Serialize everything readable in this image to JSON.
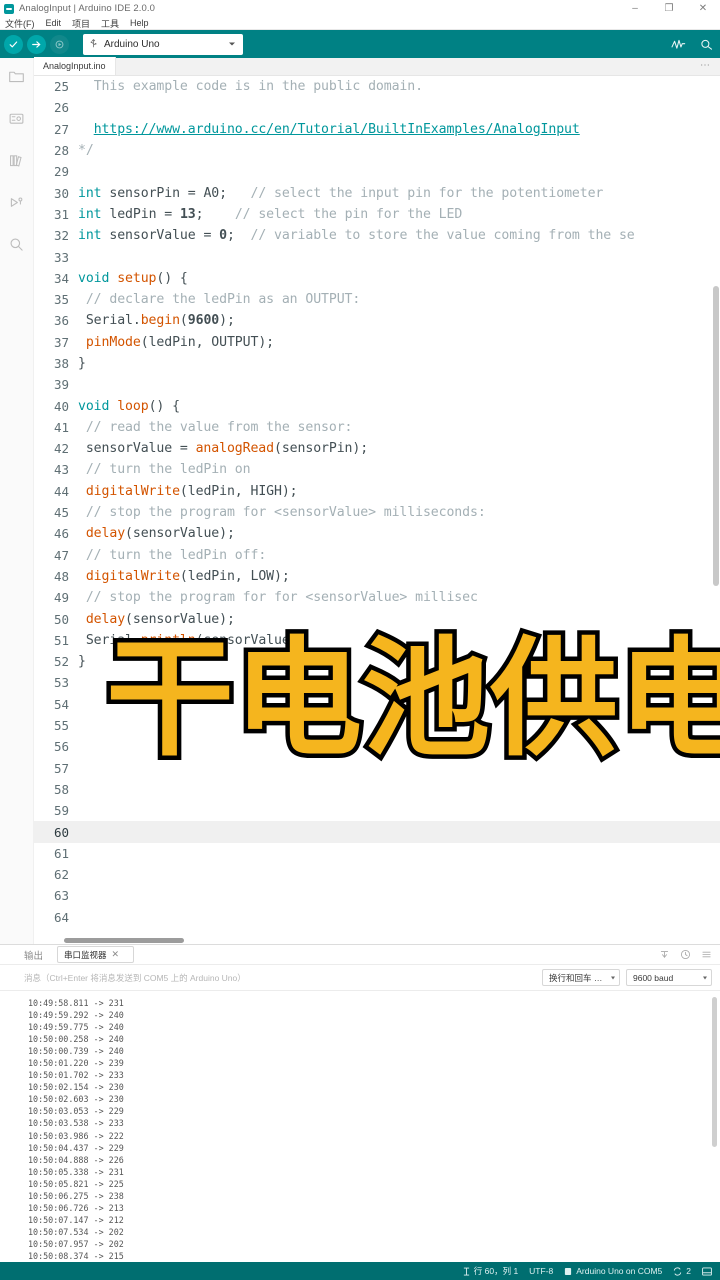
{
  "window": {
    "title": "AnalogInput | Arduino IDE 2.0.0",
    "minimize": "–",
    "maximize": "❐",
    "close": "✕"
  },
  "menubar": {
    "items": [
      {
        "label": "文件(F)"
      },
      {
        "label": "Edit"
      },
      {
        "label": "项目"
      },
      {
        "label": "工具"
      },
      {
        "label": "Help"
      }
    ]
  },
  "toolbar": {
    "verify_icon": "check-icon",
    "upload_icon": "arrow-right-icon",
    "debug_icon": "debug-play-icon",
    "board_selector": {
      "icon": "usb-icon",
      "value": "Arduino Uno"
    },
    "serial_plotter_icon": "plotter-icon",
    "serial_monitor_icon": "magnifier-icon",
    "accent_color": "#008184"
  },
  "activitybar": {
    "items": [
      {
        "icon": "folder-icon",
        "name": "sketchbook"
      },
      {
        "icon": "boards-manager-icon",
        "name": "boards-manager"
      },
      {
        "icon": "library-manager-icon",
        "name": "library-manager"
      },
      {
        "icon": "debug-icon",
        "name": "debug"
      },
      {
        "icon": "search-icon",
        "name": "search"
      }
    ]
  },
  "editor": {
    "tab_label": "AnalogInput.ino",
    "overflow_label": "⋯",
    "active_line": 60,
    "lines": [
      {
        "n": 25,
        "tokens": [
          {
            "t": "  ",
            "c": "pl"
          },
          {
            "t": "This example code is in the public domain.",
            "c": "cm"
          }
        ]
      },
      {
        "n": 26,
        "tokens": []
      },
      {
        "n": 27,
        "tokens": [
          {
            "t": "  ",
            "c": "pl"
          },
          {
            "t": "https://www.arduino.cc/en/Tutorial/BuiltInExamples/AnalogInput",
            "c": "lnk"
          }
        ]
      },
      {
        "n": 28,
        "tokens": [
          {
            "t": "*/",
            "c": "cm"
          }
        ]
      },
      {
        "n": 29,
        "tokens": []
      },
      {
        "n": 30,
        "tokens": [
          {
            "t": "int",
            "c": "k"
          },
          {
            "t": " sensorPin = A0;   ",
            "c": "pl"
          },
          {
            "t": "// select the input pin for the potentiometer",
            "c": "cm"
          }
        ]
      },
      {
        "n": 31,
        "tokens": [
          {
            "t": "int",
            "c": "k"
          },
          {
            "t": " ledPin = ",
            "c": "pl"
          },
          {
            "t": "13",
            "c": "nu"
          },
          {
            "t": ";    ",
            "c": "pl"
          },
          {
            "t": "// select the pin for the LED",
            "c": "cm"
          }
        ]
      },
      {
        "n": 32,
        "tokens": [
          {
            "t": "int",
            "c": "k"
          },
          {
            "t": " sensorValue = ",
            "c": "pl"
          },
          {
            "t": "0",
            "c": "nu"
          },
          {
            "t": ";  ",
            "c": "pl"
          },
          {
            "t": "// variable to store the value coming from the se",
            "c": "cm"
          }
        ]
      },
      {
        "n": 33,
        "tokens": []
      },
      {
        "n": 34,
        "tokens": [
          {
            "t": "void ",
            "c": "k"
          },
          {
            "t": "setup",
            "c": "fn"
          },
          {
            "t": "() {",
            "c": "pl"
          }
        ]
      },
      {
        "n": 35,
        "tokens": [
          {
            "t": " ",
            "c": "pl"
          },
          {
            "t": "// declare the ledPin as an OUTPUT:",
            "c": "cm"
          }
        ]
      },
      {
        "n": 36,
        "tokens": [
          {
            "t": " Serial.",
            "c": "pl"
          },
          {
            "t": "begin",
            "c": "fn"
          },
          {
            "t": "(",
            "c": "pl"
          },
          {
            "t": "9600",
            "c": "nu"
          },
          {
            "t": ");",
            "c": "pl"
          }
        ]
      },
      {
        "n": 37,
        "tokens": [
          {
            "t": " ",
            "c": "pl"
          },
          {
            "t": "pinMode",
            "c": "fn"
          },
          {
            "t": "(ledPin, OUTPUT);",
            "c": "pl"
          }
        ]
      },
      {
        "n": 38,
        "tokens": [
          {
            "t": "}",
            "c": "pl"
          }
        ]
      },
      {
        "n": 39,
        "tokens": []
      },
      {
        "n": 40,
        "tokens": [
          {
            "t": "void ",
            "c": "k"
          },
          {
            "t": "loop",
            "c": "fn"
          },
          {
            "t": "() {",
            "c": "pl"
          }
        ]
      },
      {
        "n": 41,
        "tokens": [
          {
            "t": " ",
            "c": "pl"
          },
          {
            "t": "// read the value from the sensor:",
            "c": "cm"
          }
        ]
      },
      {
        "n": 42,
        "tokens": [
          {
            "t": " sensorValue = ",
            "c": "pl"
          },
          {
            "t": "analogRead",
            "c": "fn"
          },
          {
            "t": "(sensorPin);",
            "c": "pl"
          }
        ]
      },
      {
        "n": 43,
        "tokens": [
          {
            "t": " ",
            "c": "pl"
          },
          {
            "t": "// turn the ledPin on",
            "c": "cm"
          }
        ]
      },
      {
        "n": 44,
        "tokens": [
          {
            "t": " ",
            "c": "pl"
          },
          {
            "t": "digitalWrite",
            "c": "fn"
          },
          {
            "t": "(ledPin, HIGH);",
            "c": "pl"
          }
        ]
      },
      {
        "n": 45,
        "tokens": [
          {
            "t": " ",
            "c": "pl"
          },
          {
            "t": "// stop the program for <sensorValue> milliseconds:",
            "c": "cm"
          }
        ]
      },
      {
        "n": 46,
        "tokens": [
          {
            "t": " ",
            "c": "pl"
          },
          {
            "t": "delay",
            "c": "fn"
          },
          {
            "t": "(sensorValue);",
            "c": "pl"
          }
        ]
      },
      {
        "n": 47,
        "tokens": [
          {
            "t": " ",
            "c": "pl"
          },
          {
            "t": "// turn the ledPin off:",
            "c": "cm"
          }
        ]
      },
      {
        "n": 48,
        "tokens": [
          {
            "t": " ",
            "c": "pl"
          },
          {
            "t": "digitalWrite",
            "c": "fn"
          },
          {
            "t": "(ledPin, LOW);",
            "c": "pl"
          }
        ]
      },
      {
        "n": 49,
        "tokens": [
          {
            "t": " ",
            "c": "pl"
          },
          {
            "t": "// stop the program for for <sensorValue> millisec",
            "c": "cm"
          }
        ]
      },
      {
        "n": 50,
        "tokens": [
          {
            "t": " ",
            "c": "pl"
          },
          {
            "t": "delay",
            "c": "fn"
          },
          {
            "t": "(sensorValue);",
            "c": "pl"
          }
        ]
      },
      {
        "n": 51,
        "tokens": [
          {
            "t": " Serial.",
            "c": "pl"
          },
          {
            "t": "println",
            "c": "fn"
          },
          {
            "t": "(sensorValue);",
            "c": "pl"
          }
        ]
      },
      {
        "n": 52,
        "tokens": [
          {
            "t": "}",
            "c": "pl"
          }
        ]
      },
      {
        "n": 53,
        "tokens": []
      },
      {
        "n": 54,
        "tokens": []
      },
      {
        "n": 55,
        "tokens": []
      },
      {
        "n": 56,
        "tokens": []
      },
      {
        "n": 57,
        "tokens": []
      },
      {
        "n": 58,
        "tokens": []
      },
      {
        "n": 59,
        "tokens": []
      },
      {
        "n": 60,
        "tokens": []
      },
      {
        "n": 61,
        "tokens": []
      },
      {
        "n": 62,
        "tokens": []
      },
      {
        "n": 63,
        "tokens": []
      },
      {
        "n": 64,
        "tokens": []
      }
    ]
  },
  "overlay": {
    "caption": "干电池供电",
    "fill_color": "#f5b51e",
    "stroke_color": "#000000"
  },
  "panel": {
    "tabs": [
      {
        "label": "输出",
        "selected": false,
        "closable": false
      },
      {
        "label": "串口监视器",
        "selected": true,
        "closable": true,
        "close": "✕"
      }
    ],
    "tools": [
      {
        "icon": "clear-output-icon"
      },
      {
        "icon": "toggle-timestamp-icon"
      },
      {
        "icon": "menu-icon"
      }
    ],
    "message_input_placeholder": "消息（Ctrl+Enter 将消息发送到 COM5 上的 Arduino Uno）",
    "line_ending_select": "换行和回车 …",
    "baud_select": "9600 baud",
    "log": [
      "10:49:58.811 -> 231",
      "10:49:59.292 -> 240",
      "10:49:59.775 -> 240",
      "10:50:00.258 -> 240",
      "10:50:00.739 -> 240",
      "10:50:01.220 -> 239",
      "10:50:01.702 -> 233",
      "10:50:02.154 -> 230",
      "10:50:02.603 -> 230",
      "10:50:03.053 -> 229",
      "10:50:03.538 -> 233",
      "10:50:03.986 -> 222",
      "10:50:04.437 -> 229",
      "10:50:04.888 -> 226",
      "10:50:05.338 -> 231",
      "10:50:05.821 -> 225",
      "10:50:06.275 -> 238",
      "10:50:06.726 -> 213",
      "10:50:07.147 -> 212",
      "10:50:07.534 -> 202",
      "10:50:07.957 -> 202",
      "10:50:08.374 -> 215"
    ]
  },
  "statusbar": {
    "cursor": "行 60，列 1",
    "encoding": "UTF-8",
    "board": "Arduino Uno on COM5",
    "notifications": "2",
    "panel_toggle_icon": "panel-icon",
    "background": "#006e70"
  }
}
